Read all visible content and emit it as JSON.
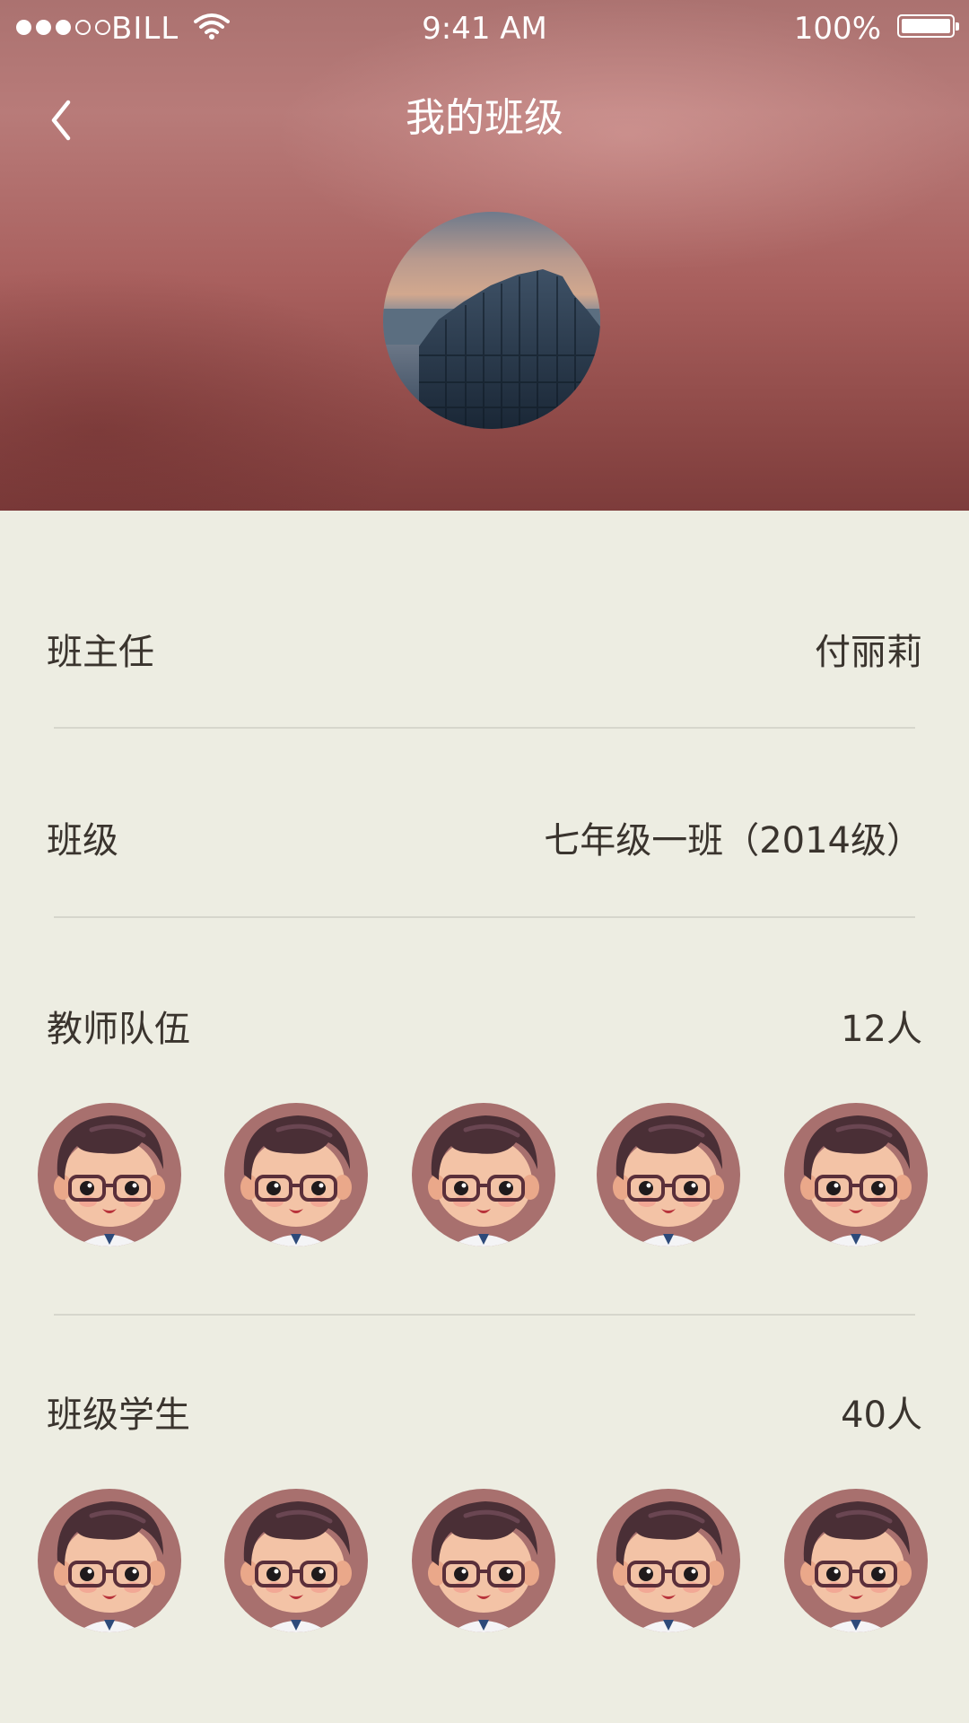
{
  "status_bar": {
    "carrier": "BILL",
    "time": "9:41 AM",
    "battery": "100%"
  },
  "nav": {
    "title": "我的班级",
    "back_icon": "chevron-left-icon"
  },
  "header": {
    "class_photo": "coastal-rock-columns-photo"
  },
  "info": {
    "head_teacher": {
      "label": "班主任",
      "value": "付丽莉"
    },
    "class": {
      "label": "班级",
      "value": "七年级一班（2014级）"
    },
    "teachers": {
      "label": "教师队伍",
      "count": "12人"
    },
    "students": {
      "label": "班级学生",
      "count": "40人"
    }
  },
  "colors": {
    "header_top": "#b57876",
    "header_bottom": "#7d3c3b",
    "page_background": "#edede2",
    "text": "#3a342e",
    "divider": "#d6d6cc"
  }
}
